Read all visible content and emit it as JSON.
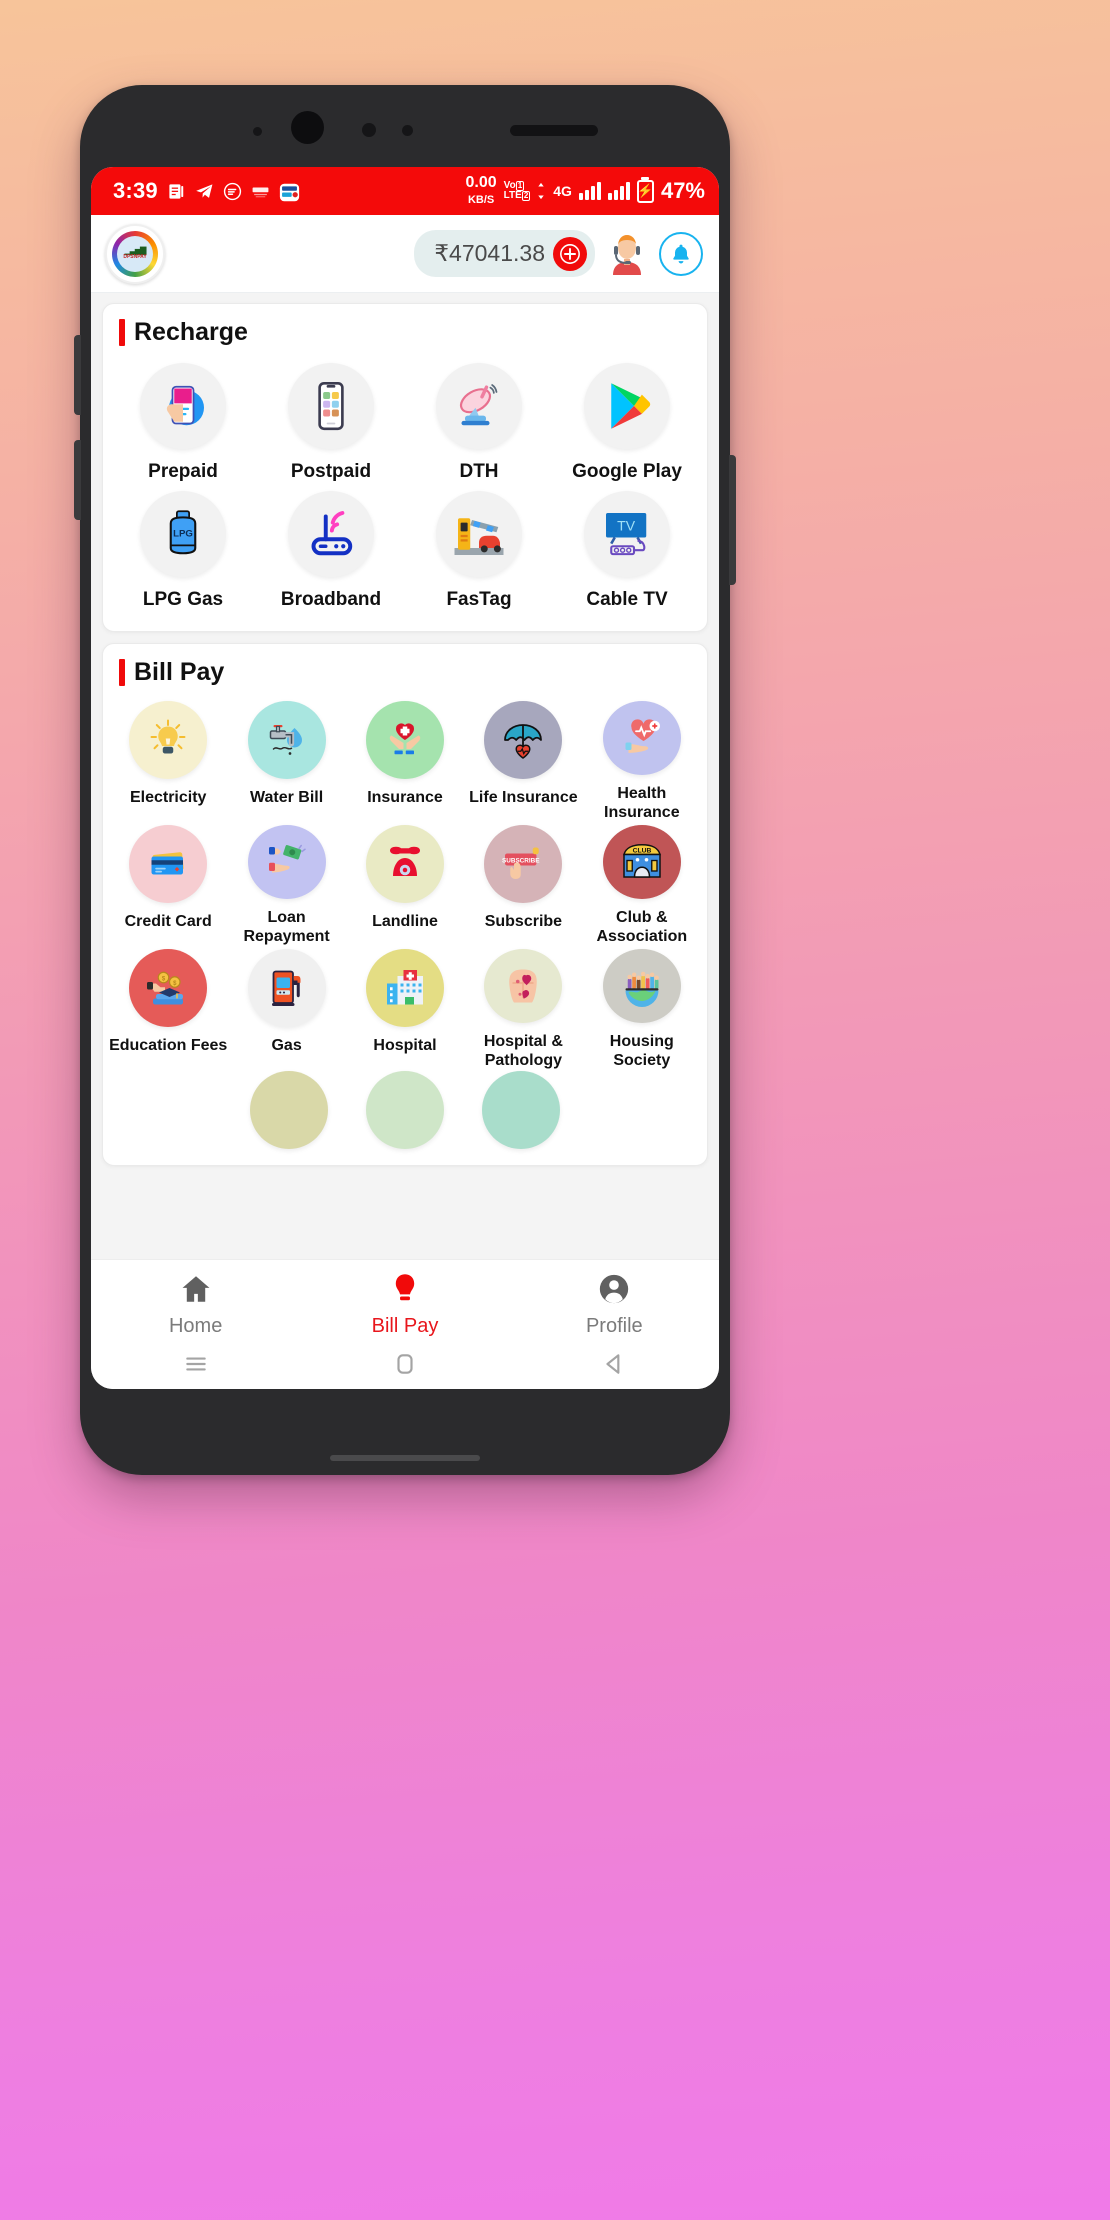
{
  "status_bar": {
    "time": "3:39",
    "left_icons": [
      "notes-icon",
      "telegram-icon",
      "spotify-icon",
      "paytm-icon",
      "bank-app-icon"
    ],
    "data_rate_value": "0.00",
    "data_rate_unit": "KB/S",
    "volte_line1": "Vo",
    "volte_line2": "LTE",
    "sim1_badge": "1",
    "sim2_badge": "2",
    "network_type": "4G",
    "battery_percent": "47%",
    "background_color": "#f40a0a"
  },
  "header": {
    "logo_text": "DPSNPAY",
    "logo_sub": "DPS",
    "balance": "₹47041.38",
    "add_money_label": "+",
    "support_icon": "support-agent-icon",
    "notification_icon": "bell-icon"
  },
  "recharge": {
    "title": "Recharge",
    "accent_color": "#f00a0a",
    "items": [
      {
        "label": "Prepaid",
        "icon": "hand-holding-phone-icon",
        "bg": "#f2f2f2"
      },
      {
        "label": "Postpaid",
        "icon": "smartphone-apps-icon",
        "bg": "#f2f2f2"
      },
      {
        "label": "DTH",
        "icon": "satellite-dish-icon",
        "bg": "#f2f2f2"
      },
      {
        "label": "Google Play",
        "icon": "google-play-icon",
        "bg": "#f2f2f2"
      },
      {
        "label": "LPG Gas",
        "icon": "lpg-cylinder-icon",
        "bg": "#f2f2f2"
      },
      {
        "label": "Broadband",
        "icon": "wifi-router-icon",
        "bg": "#f2f2f2"
      },
      {
        "label": "FasTag",
        "icon": "toll-barrier-car-icon",
        "bg": "#f2f2f2"
      },
      {
        "label": "Cable TV",
        "icon": "cable-tv-icon",
        "bg": "#f2f2f2"
      }
    ]
  },
  "bill_pay": {
    "title": "Bill Pay",
    "accent_color": "#f00a0a",
    "items": [
      {
        "label": "Electricity",
        "icon": "light-bulb-icon",
        "bg": "#f6f0cf"
      },
      {
        "label": "Water Bill",
        "icon": "water-tap-icon",
        "bg": "#a9e6e0"
      },
      {
        "label": "Insurance",
        "icon": "hands-heart-icon",
        "bg": "#a5e3ae"
      },
      {
        "label": "Life Insurance",
        "icon": "umbrella-heart-icon",
        "bg": "#a7a7bd"
      },
      {
        "label": "Health Insurance",
        "icon": "heart-pulse-hand-icon",
        "bg": "#c0c3ef"
      },
      {
        "label": "Credit Card",
        "icon": "credit-card-icon",
        "bg": "#f6cdd1"
      },
      {
        "label": "Loan Repayment",
        "icon": "cash-exchange-icon",
        "bg": "#c2c3f2"
      },
      {
        "label": "Landline",
        "icon": "landline-phone-icon",
        "bg": "#e9eac4"
      },
      {
        "label": "Subscribe",
        "icon": "subscribe-button-icon",
        "bg": "#d5b3b7"
      },
      {
        "label": "Club & Association",
        "icon": "club-building-icon",
        "bg": "#c05556"
      },
      {
        "label": "Education Fees",
        "icon": "education-money-icon",
        "bg": "#e55b58"
      },
      {
        "label": "Gas",
        "icon": "fuel-pump-icon",
        "bg": "#f0f0f0"
      },
      {
        "label": "Hospital",
        "icon": "hospital-building-icon",
        "bg": "#e4dd84"
      },
      {
        "label": "Hospital & Pathology",
        "icon": "human-torso-icon",
        "bg": "#e6e9d0"
      },
      {
        "label": "Housing Society",
        "icon": "people-globe-icon",
        "bg": "#cdccc5"
      }
    ],
    "next_row_peek": [
      "#d9d8a8",
      "#cfe6c8",
      "#a9ddcb"
    ]
  },
  "bottom_nav": {
    "items": [
      {
        "label": "Home",
        "icon": "home-icon",
        "active": false
      },
      {
        "label": "Bill Pay",
        "icon": "bulb-icon",
        "active": true
      },
      {
        "label": "Profile",
        "icon": "profile-icon",
        "active": false
      }
    ],
    "active_color": "#e8161c",
    "inactive_color": "#7b7b7b"
  },
  "system_nav": {
    "recents": "recents-icon",
    "home": "home-square-icon",
    "back": "back-triangle-icon"
  }
}
